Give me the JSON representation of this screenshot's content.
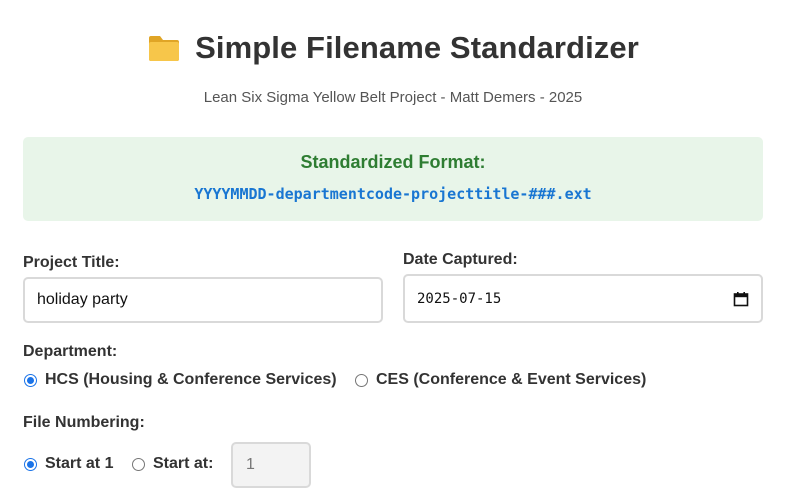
{
  "header": {
    "icon": "folder-icon",
    "title": "Simple Filename Standardizer",
    "subtitle": "Lean Six Sigma Yellow Belt Project - Matt Demers - 2025"
  },
  "format": {
    "heading": "Standardized Format:",
    "pattern": "YYYYMMDD-departmentcode-projecttitle-###.ext"
  },
  "form": {
    "project_title": {
      "label": "Project Title:",
      "value": "holiday party"
    },
    "date_captured": {
      "label": "Date Captured:",
      "value": "2025-07-15",
      "icon": "calendar-icon"
    },
    "department": {
      "label": "Department:",
      "options": [
        {
          "label": "HCS (Housing & Conference Services)",
          "checked": true
        },
        {
          "label": "CES (Conference & Event Services)",
          "checked": false
        }
      ]
    },
    "file_numbering": {
      "label": "File Numbering:",
      "option_start_1": {
        "label": "Start at 1",
        "checked": true
      },
      "option_start_at": {
        "label": "Start at:",
        "checked": false
      },
      "start_value": "1"
    }
  },
  "colors": {
    "format_bg": "#e8f5e9",
    "format_heading": "#2e7d32",
    "format_pattern": "#1976d2",
    "radio_accent": "#1a73e8"
  }
}
